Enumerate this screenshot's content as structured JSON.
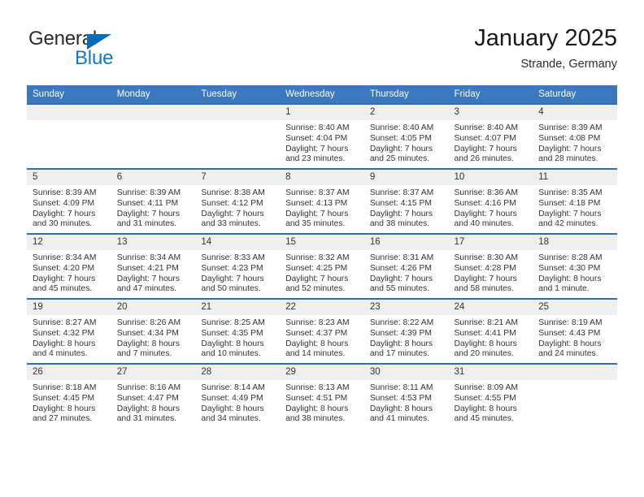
{
  "logo": {
    "word1": "General",
    "word2": "Blue",
    "triangle_color": "#0b6bb8",
    "blue_color": "#1478c8"
  },
  "header": {
    "title": "January 2025",
    "subtitle": "Strande, Germany"
  },
  "theme": {
    "header_bg": "#3b78bd",
    "row_divider": "#2f6fb5",
    "daynum_bg": "#efefef"
  },
  "weekday_headers": [
    "Sunday",
    "Monday",
    "Tuesday",
    "Wednesday",
    "Thursday",
    "Friday",
    "Saturday"
  ],
  "labels": {
    "sunrise_prefix": "Sunrise:",
    "sunset_prefix": "Sunset:",
    "daylight_prefix": "Daylight:"
  },
  "weeks": [
    [
      {
        "day": "",
        "empty": true
      },
      {
        "day": "",
        "empty": true
      },
      {
        "day": "",
        "empty": true
      },
      {
        "day": "1",
        "sunrise": "Sunrise: 8:40 AM",
        "sunset": "Sunset: 4:04 PM",
        "daylight1": "Daylight: 7 hours",
        "daylight2": "and 23 minutes."
      },
      {
        "day": "2",
        "sunrise": "Sunrise: 8:40 AM",
        "sunset": "Sunset: 4:05 PM",
        "daylight1": "Daylight: 7 hours",
        "daylight2": "and 25 minutes."
      },
      {
        "day": "3",
        "sunrise": "Sunrise: 8:40 AM",
        "sunset": "Sunset: 4:07 PM",
        "daylight1": "Daylight: 7 hours",
        "daylight2": "and 26 minutes."
      },
      {
        "day": "4",
        "sunrise": "Sunrise: 8:39 AM",
        "sunset": "Sunset: 4:08 PM",
        "daylight1": "Daylight: 7 hours",
        "daylight2": "and 28 minutes."
      }
    ],
    [
      {
        "day": "5",
        "sunrise": "Sunrise: 8:39 AM",
        "sunset": "Sunset: 4:09 PM",
        "daylight1": "Daylight: 7 hours",
        "daylight2": "and 30 minutes."
      },
      {
        "day": "6",
        "sunrise": "Sunrise: 8:39 AM",
        "sunset": "Sunset: 4:11 PM",
        "daylight1": "Daylight: 7 hours",
        "daylight2": "and 31 minutes."
      },
      {
        "day": "7",
        "sunrise": "Sunrise: 8:38 AM",
        "sunset": "Sunset: 4:12 PM",
        "daylight1": "Daylight: 7 hours",
        "daylight2": "and 33 minutes."
      },
      {
        "day": "8",
        "sunrise": "Sunrise: 8:37 AM",
        "sunset": "Sunset: 4:13 PM",
        "daylight1": "Daylight: 7 hours",
        "daylight2": "and 35 minutes."
      },
      {
        "day": "9",
        "sunrise": "Sunrise: 8:37 AM",
        "sunset": "Sunset: 4:15 PM",
        "daylight1": "Daylight: 7 hours",
        "daylight2": "and 38 minutes."
      },
      {
        "day": "10",
        "sunrise": "Sunrise: 8:36 AM",
        "sunset": "Sunset: 4:16 PM",
        "daylight1": "Daylight: 7 hours",
        "daylight2": "and 40 minutes."
      },
      {
        "day": "11",
        "sunrise": "Sunrise: 8:35 AM",
        "sunset": "Sunset: 4:18 PM",
        "daylight1": "Daylight: 7 hours",
        "daylight2": "and 42 minutes."
      }
    ],
    [
      {
        "day": "12",
        "sunrise": "Sunrise: 8:34 AM",
        "sunset": "Sunset: 4:20 PM",
        "daylight1": "Daylight: 7 hours",
        "daylight2": "and 45 minutes."
      },
      {
        "day": "13",
        "sunrise": "Sunrise: 8:34 AM",
        "sunset": "Sunset: 4:21 PM",
        "daylight1": "Daylight: 7 hours",
        "daylight2": "and 47 minutes."
      },
      {
        "day": "14",
        "sunrise": "Sunrise: 8:33 AM",
        "sunset": "Sunset: 4:23 PM",
        "daylight1": "Daylight: 7 hours",
        "daylight2": "and 50 minutes."
      },
      {
        "day": "15",
        "sunrise": "Sunrise: 8:32 AM",
        "sunset": "Sunset: 4:25 PM",
        "daylight1": "Daylight: 7 hours",
        "daylight2": "and 52 minutes."
      },
      {
        "day": "16",
        "sunrise": "Sunrise: 8:31 AM",
        "sunset": "Sunset: 4:26 PM",
        "daylight1": "Daylight: 7 hours",
        "daylight2": "and 55 minutes."
      },
      {
        "day": "17",
        "sunrise": "Sunrise: 8:30 AM",
        "sunset": "Sunset: 4:28 PM",
        "daylight1": "Daylight: 7 hours",
        "daylight2": "and 58 minutes."
      },
      {
        "day": "18",
        "sunrise": "Sunrise: 8:28 AM",
        "sunset": "Sunset: 4:30 PM",
        "daylight1": "Daylight: 8 hours",
        "daylight2": "and 1 minute."
      }
    ],
    [
      {
        "day": "19",
        "sunrise": "Sunrise: 8:27 AM",
        "sunset": "Sunset: 4:32 PM",
        "daylight1": "Daylight: 8 hours",
        "daylight2": "and 4 minutes."
      },
      {
        "day": "20",
        "sunrise": "Sunrise: 8:26 AM",
        "sunset": "Sunset: 4:34 PM",
        "daylight1": "Daylight: 8 hours",
        "daylight2": "and 7 minutes."
      },
      {
        "day": "21",
        "sunrise": "Sunrise: 8:25 AM",
        "sunset": "Sunset: 4:35 PM",
        "daylight1": "Daylight: 8 hours",
        "daylight2": "and 10 minutes."
      },
      {
        "day": "22",
        "sunrise": "Sunrise: 8:23 AM",
        "sunset": "Sunset: 4:37 PM",
        "daylight1": "Daylight: 8 hours",
        "daylight2": "and 14 minutes."
      },
      {
        "day": "23",
        "sunrise": "Sunrise: 8:22 AM",
        "sunset": "Sunset: 4:39 PM",
        "daylight1": "Daylight: 8 hours",
        "daylight2": "and 17 minutes."
      },
      {
        "day": "24",
        "sunrise": "Sunrise: 8:21 AM",
        "sunset": "Sunset: 4:41 PM",
        "daylight1": "Daylight: 8 hours",
        "daylight2": "and 20 minutes."
      },
      {
        "day": "25",
        "sunrise": "Sunrise: 8:19 AM",
        "sunset": "Sunset: 4:43 PM",
        "daylight1": "Daylight: 8 hours",
        "daylight2": "and 24 minutes."
      }
    ],
    [
      {
        "day": "26",
        "sunrise": "Sunrise: 8:18 AM",
        "sunset": "Sunset: 4:45 PM",
        "daylight1": "Daylight: 8 hours",
        "daylight2": "and 27 minutes."
      },
      {
        "day": "27",
        "sunrise": "Sunrise: 8:16 AM",
        "sunset": "Sunset: 4:47 PM",
        "daylight1": "Daylight: 8 hours",
        "daylight2": "and 31 minutes."
      },
      {
        "day": "28",
        "sunrise": "Sunrise: 8:14 AM",
        "sunset": "Sunset: 4:49 PM",
        "daylight1": "Daylight: 8 hours",
        "daylight2": "and 34 minutes."
      },
      {
        "day": "29",
        "sunrise": "Sunrise: 8:13 AM",
        "sunset": "Sunset: 4:51 PM",
        "daylight1": "Daylight: 8 hours",
        "daylight2": "and 38 minutes."
      },
      {
        "day": "30",
        "sunrise": "Sunrise: 8:11 AM",
        "sunset": "Sunset: 4:53 PM",
        "daylight1": "Daylight: 8 hours",
        "daylight2": "and 41 minutes."
      },
      {
        "day": "31",
        "sunrise": "Sunrise: 8:09 AM",
        "sunset": "Sunset: 4:55 PM",
        "daylight1": "Daylight: 8 hours",
        "daylight2": "and 45 minutes."
      },
      {
        "day": "",
        "empty": true
      }
    ]
  ]
}
